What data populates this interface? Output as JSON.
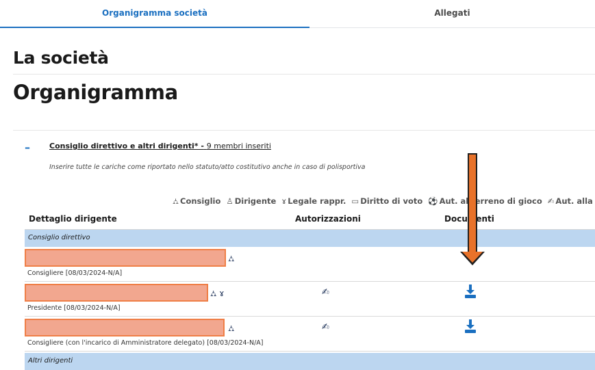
{
  "tabs": [
    {
      "label": "Organigramma società",
      "active": true
    },
    {
      "label": "Allegati",
      "active": false
    }
  ],
  "page_title": "La società",
  "section_heading": "Organigramma",
  "section": {
    "collapse_symbol": "–",
    "title": "Consiglio direttivo e altri dirigenti* -",
    "count": "9 membri inseriti",
    "note": "Inserire tutte le cariche come riportato nello statuto/atto costitutivo anche in caso di polisportiva"
  },
  "legend": [
    {
      "icon": "org-chart-icon",
      "glyph": "⛼",
      "label": "Consiglio"
    },
    {
      "icon": "person-icon",
      "glyph": "♙",
      "label": "Dirigente"
    },
    {
      "icon": "medal-icon",
      "glyph": "ɤ",
      "label": "Legale rappr."
    },
    {
      "icon": "ballot-icon",
      "glyph": "▭",
      "label": "Diritto di voto"
    },
    {
      "icon": "soccer-ball-icon",
      "glyph": "⚽",
      "label": "Aut. al terreno di gioco"
    },
    {
      "icon": "signature-icon",
      "glyph": "✍",
      "label": "Aut. alla firma"
    }
  ],
  "table": {
    "headers": [
      "Dettaglio dirigente",
      "Autorizzazioni",
      "Documenti"
    ],
    "groups": [
      "Consiglio direttivo",
      "Altri dirigenti"
    ],
    "rows": [
      {
        "role": "Consigliere [08/03/2024-N/A]",
        "role_icons": "⛼",
        "has_auth": false,
        "has_doc": false
      },
      {
        "role": "Presidente [08/03/2024-N/A]",
        "role_icons": "⛼ ɤ",
        "has_auth": true,
        "has_doc": true
      },
      {
        "role": "Consigliere (con l'incarico di Amministratore delegato) [08/03/2024-N/A]",
        "role_icons": "⛼",
        "has_auth": true,
        "has_doc": true
      }
    ]
  },
  "colors": {
    "accent": "#1a6fc0",
    "group_bg": "#bcd6f0",
    "redaction": "#f2a78f",
    "annotation_arrow": "#e8722a"
  }
}
